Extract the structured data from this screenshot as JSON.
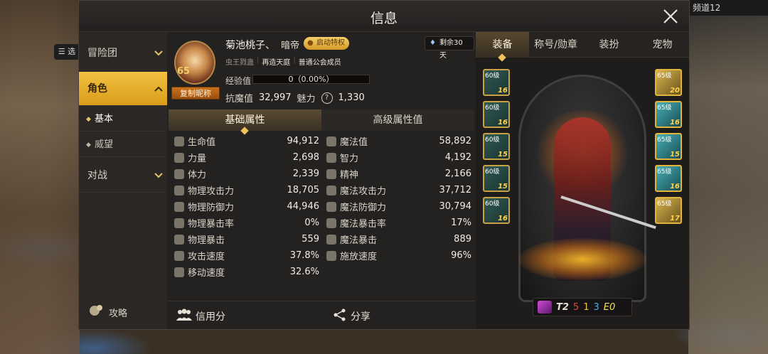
{
  "background": {
    "left_tag": "☰ 选",
    "right_tag": "频道12"
  },
  "window": {
    "title": "信息"
  },
  "nav": {
    "items": [
      {
        "label": "冒险团",
        "chevron": "v"
      },
      {
        "label": "角色",
        "chevron": "^"
      },
      {
        "label": "对战",
        "chevron": "v"
      }
    ],
    "sub_items": [
      {
        "label": "基本"
      },
      {
        "label": "威望"
      }
    ],
    "guide_label": "攻略"
  },
  "profile": {
    "name": "菊池桃子、",
    "class": "暗帝",
    "privilege": "启动特权",
    "level": "65",
    "copy_name_button": "复制昵称",
    "tags": [
      "虫王戮蛊",
      "再造天庭",
      "普通公会成员"
    ],
    "exp_label": "经验值",
    "exp_value": "0（0.00%）",
    "exp_fraction": 0,
    "resist_label": "抗魔值",
    "resist_value": "32,997",
    "charm_label": "魅力",
    "charm_value": "1,330",
    "remaining": "剩余30天"
  },
  "tabs": [
    {
      "label": "基础属性"
    },
    {
      "label": "高级属性值"
    }
  ],
  "attributes": {
    "left": [
      {
        "label": "生命值",
        "value": "94,912"
      },
      {
        "label": "力量",
        "value": "2,698"
      },
      {
        "label": "体力",
        "value": "2,339"
      },
      {
        "label": "物理攻击力",
        "value": "18,705"
      },
      {
        "label": "物理防御力",
        "value": "44,946"
      },
      {
        "label": "物理暴击率",
        "value": "0%"
      },
      {
        "label": "物理暴击",
        "value": "559"
      },
      {
        "label": "攻击速度",
        "value": "37.8%"
      },
      {
        "label": "移动速度",
        "value": "32.6%"
      }
    ],
    "right": [
      {
        "label": "魔法值",
        "value": "58,892"
      },
      {
        "label": "智力",
        "value": "4,192"
      },
      {
        "label": "精神",
        "value": "2,166"
      },
      {
        "label": "魔法攻击力",
        "value": "37,712"
      },
      {
        "label": "魔法防御力",
        "value": "30,794"
      },
      {
        "label": "魔法暴击率",
        "value": "17%"
      },
      {
        "label": "魔法暴击",
        "value": "889"
      },
      {
        "label": "施放速度",
        "value": "96%"
      }
    ]
  },
  "footer": {
    "credit": "信用分",
    "share": "分享"
  },
  "equip_tabs": [
    {
      "label": "装备"
    },
    {
      "label": "称号/勋章"
    },
    {
      "label": "装扮"
    },
    {
      "label": "宠物"
    }
  ],
  "equip_left": [
    {
      "level": "60级",
      "up": "16"
    },
    {
      "level": "60级",
      "up": "16"
    },
    {
      "level": "60级",
      "up": "15"
    },
    {
      "level": "60级",
      "up": "15"
    },
    {
      "level": "60级",
      "up": "16"
    }
  ],
  "equip_right": [
    {
      "level": "65级",
      "up": "20"
    },
    {
      "level": "65级",
      "up": "16"
    },
    {
      "level": "65级",
      "up": "15"
    },
    {
      "level": "65级",
      "up": "16"
    },
    {
      "level": "65级",
      "up": "17"
    }
  ],
  "badge": {
    "t_label": "T2",
    "n1": "5",
    "n2": "1",
    "n3": "3",
    "e_label": "E0"
  }
}
